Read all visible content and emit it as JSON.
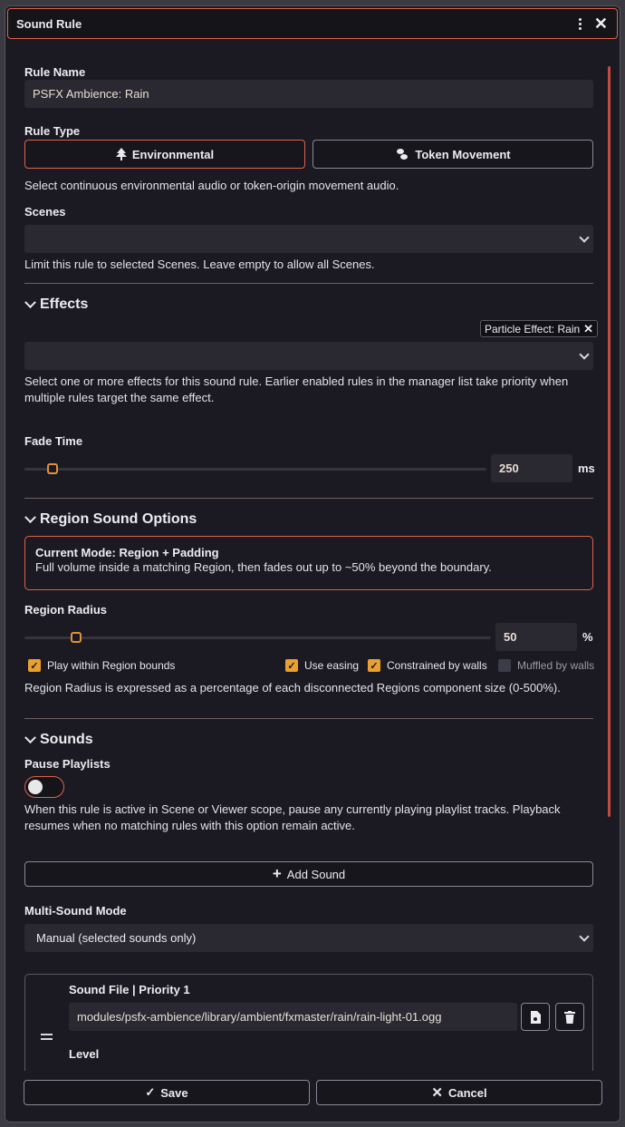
{
  "window": {
    "title": "Sound Rule"
  },
  "rule_name": {
    "label": "Rule Name",
    "value": "PSFX Ambience: Rain"
  },
  "rule_type": {
    "label": "Rule Type",
    "environmental": "Environmental",
    "token_movement": "Token Movement",
    "help": "Select continuous environmental audio or token-origin movement audio."
  },
  "scenes": {
    "label": "Scenes",
    "value": "",
    "help": "Limit this rule to selected Scenes. Leave empty to allow all Scenes."
  },
  "effects": {
    "heading": "Effects",
    "tag": "Particle Effect: Rain",
    "help": "Select one or more effects for this sound rule. Earlier enabled rules in the manager list take priority when multiple rules target the same effect."
  },
  "fade": {
    "label": "Fade Time",
    "value": "250",
    "unit": "ms",
    "fraction": 0.06
  },
  "region": {
    "heading": "Region Sound Options",
    "mode_title": "Current Mode: Region + Padding",
    "mode_desc": "Full volume inside a matching Region, then fades out up to ~50% beyond the boundary.",
    "radius_label": "Region Radius",
    "radius_value": "50",
    "radius_unit": "%",
    "radius_fraction": 0.11,
    "options": {
      "play_within": "Play within Region bounds",
      "use_easing": "Use easing",
      "constrained": "Constrained by walls",
      "muffled": "Muffled by walls"
    },
    "help": "Region Radius is expressed as a percentage of each disconnected Regions component size (0-500%)."
  },
  "sounds": {
    "heading": "Sounds",
    "pause_label": "Pause Playlists",
    "pause_help": "When this rule is active in Scene or Viewer scope, pause any currently playing playlist tracks. Playback resumes when no matching rules with this option remain active.",
    "add_sound": "Add Sound",
    "multi_label": "Multi-Sound Mode",
    "multi_value": "Manual (selected sounds only)",
    "file_label": "Sound File | Priority 1",
    "file_value": "modules/psfx-ambience/library/ambient/fxmaster/rain/rain-light-01.ogg",
    "level_label": "Level"
  },
  "footer": {
    "save": "Save",
    "cancel": "Cancel"
  },
  "colors": {
    "accent": "#e0624a",
    "checkbox": "#e8a030",
    "background": "#1b1a22"
  }
}
